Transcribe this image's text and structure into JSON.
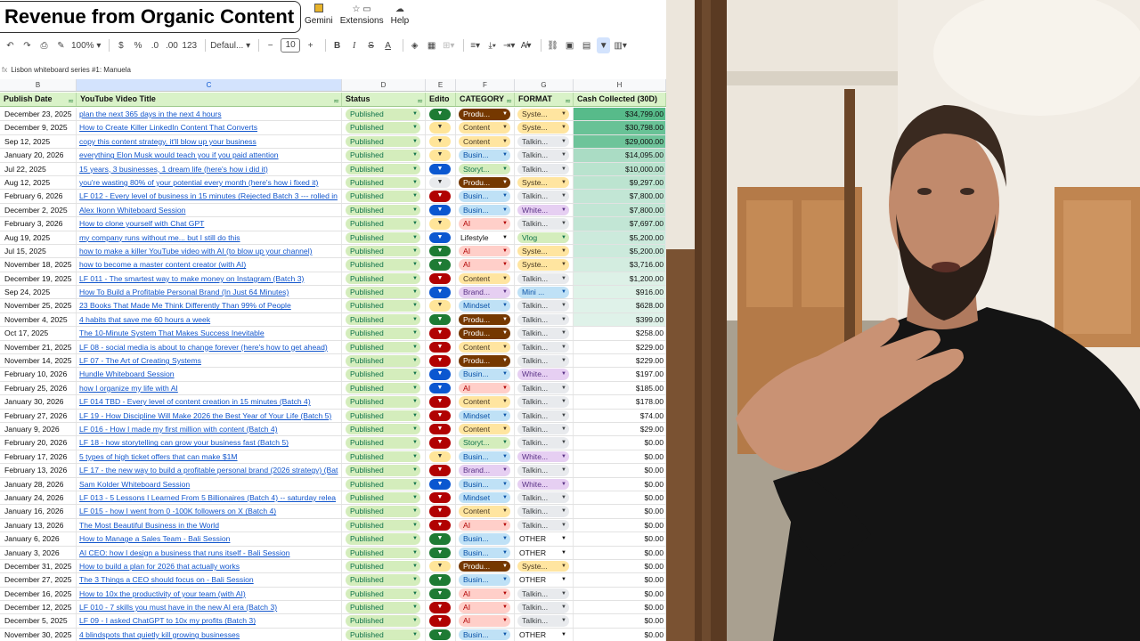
{
  "doc_title": "Revenue from Organic Content",
  "menu": [
    {
      "label": "Gemini",
      "icon": "gemini-icon"
    },
    {
      "label": "Extensions",
      "icon": "extensions-icon"
    },
    {
      "label": "Help",
      "icon": "help-icon"
    }
  ],
  "toolbar": {
    "zoom": "100%",
    "currency": "$",
    "percent": "%",
    "dec_less": ".0",
    "dec_more": ".00",
    "number_format": "123",
    "font": "Defaul...",
    "font_size": "10"
  },
  "formula_bar": {
    "value": "Lisbon whiteboard series #1: Manuela"
  },
  "columns": {
    "letters": [
      "B",
      "C",
      "D",
      "E",
      "F",
      "G",
      "H"
    ],
    "headers": {
      "publish_date": "Publish Date",
      "title": "YouTube Video Title",
      "status": "Status",
      "editor": "Edito",
      "category": "CATEGORY",
      "format": "FORMAT",
      "cash": "Cash Collected (30D)"
    }
  },
  "colors": {
    "status_bg": "#d4edbc",
    "editor_green": "#1e7b34",
    "editor_blue": "#0b57d0",
    "editor_red": "#b10202",
    "editor_yellow": "#ffe599",
    "editor_white": "#e8eaed",
    "cat_product": "#753800",
    "cat_content": "#ffe5a0",
    "cat_business": "#bfe1f6",
    "cat_story": "#d4edbc",
    "cat_ai": "#ffcfc9",
    "cat_brand": "#e6cff2",
    "cat_mindset": "#bfe1f6",
    "fmt_system": "#ffe5a0",
    "fmt_talking": "#e8eaed",
    "fmt_white": "#e6cff2",
    "fmt_vlog": "#d4edbc",
    "fmt_mini": "#bfe1f6",
    "cash_high": "#57bb8a"
  },
  "rows": [
    {
      "date": "December 23, 2025",
      "title": "plan the next 365 days in the next 4 hours",
      "status": "Published",
      "editor": "green",
      "category": "Produ...",
      "cat_style": "product",
      "format": "Syste...",
      "fmt_style": "system",
      "cash": "$34,799.00",
      "cash_level": 1.0
    },
    {
      "date": "December 9, 2025",
      "title": "How to Create Killer LinkedIn Content That Converts",
      "status": "Published",
      "editor": "yellow",
      "category": "Content",
      "cat_style": "content",
      "format": "Syste...",
      "fmt_style": "system",
      "cash": "$30,798.00",
      "cash_level": 0.88
    },
    {
      "date": "Sep 12, 2025",
      "title": "copy this content strategy, it'll blow up your business",
      "status": "Published",
      "editor": "yellow",
      "category": "Content",
      "cat_style": "content",
      "format": "Talkin...",
      "fmt_style": "talking",
      "cash": "$29,000.00",
      "cash_level": 0.83
    },
    {
      "date": "January 20, 2026",
      "title": "everything Elon Musk would teach you if you paid attention",
      "status": "Published",
      "editor": "yellow",
      "category": "Busin...",
      "cat_style": "business",
      "format": "Talkin...",
      "fmt_style": "talking",
      "cash": "$14,095.00",
      "cash_level": 0.4
    },
    {
      "date": "Jul 22, 2025",
      "title": "15 years, 3 businesses, 1 dream life (here's how i did it)",
      "status": "Published",
      "editor": "blue",
      "category": "Storyt...",
      "cat_style": "story",
      "format": "Talkin...",
      "fmt_style": "talking",
      "cash": "$10,000.00",
      "cash_level": 0.29
    },
    {
      "date": "Aug 12, 2025",
      "title": "you're wasting 80% of your potential every month (here's how i fixed it)",
      "status": "Published",
      "editor": "white",
      "category": "Produ...",
      "cat_style": "product",
      "format": "Syste...",
      "fmt_style": "system",
      "cash": "$9,297.00",
      "cash_level": 0.27
    },
    {
      "date": "February 6, 2026",
      "title": "LF 012 - Every level of business in 15 minutes (Rejected Batch 3 --- rolled in",
      "status": "Published",
      "editor": "red",
      "category": "Busin...",
      "cat_style": "business",
      "format": "Talkin...",
      "fmt_style": "talking",
      "cash": "$7,800.00",
      "cash_level": 0.22
    },
    {
      "date": "December 2, 2025",
      "title": "Alex Ikonn Whiteboard Session",
      "status": "Published",
      "editor": "blue",
      "category": "Busin...",
      "cat_style": "business",
      "format": "White...",
      "fmt_style": "white",
      "cash": "$7,800.00",
      "cash_level": 0.22
    },
    {
      "date": "February 3, 2026",
      "title": "How to clone yourself with Chat GPT",
      "status": "Published",
      "editor": "yellow",
      "category": "AI",
      "cat_style": "ai",
      "format": "Talkin...",
      "fmt_style": "talking",
      "cash": "$7,697.00",
      "cash_level": 0.22
    },
    {
      "date": "Aug 19, 2025",
      "title": "my company runs without me... but I still do this",
      "status": "Published",
      "editor": "blue",
      "category": "Lifestyle",
      "cat_style": "plain",
      "format": "Vlog",
      "fmt_style": "vlog",
      "cash": "$5,200.00",
      "cash_level": 0.15
    },
    {
      "date": "Jul 15, 2025",
      "title": "how to make a killer YouTube video with AI (to blow up your channel)",
      "status": "Published",
      "editor": "green",
      "category": "AI",
      "cat_style": "ai",
      "format": "Syste...",
      "fmt_style": "system",
      "cash": "$5,200.00",
      "cash_level": 0.15
    },
    {
      "date": "November 18, 2025",
      "title": "how to become a master content creator (with AI)",
      "status": "Published",
      "editor": "green",
      "category": "AI",
      "cat_style": "ai",
      "format": "Syste...",
      "fmt_style": "system",
      "cash": "$3,716.00",
      "cash_level": 0.1
    },
    {
      "date": "December 19, 2025",
      "title": "LF 011 - The smartest way to make money on Instagram (Batch 3)",
      "status": "Published",
      "editor": "red",
      "category": "Content",
      "cat_style": "content",
      "format": "Talkin...",
      "fmt_style": "talking",
      "cash": "$1,200.00",
      "cash_level": 0.03
    },
    {
      "date": "Sep 24, 2025",
      "title": "How To Build a Profitable Personal Brand (In Just 64 Minutes)",
      "status": "Published",
      "editor": "blue",
      "category": "Brand...",
      "cat_style": "brand",
      "format": "Mini ...",
      "fmt_style": "mini",
      "cash": "$916.00",
      "cash_level": 0.02
    },
    {
      "date": "November 25, 2025",
      "title": "23 Books That Made Me Think Differently Than 99% of People",
      "status": "Published",
      "editor": "yellow",
      "category": "Mindset",
      "cat_style": "mindset",
      "format": "Talkin...",
      "fmt_style": "talking",
      "cash": "$628.00",
      "cash_level": 0.01
    },
    {
      "date": "November 4, 2025",
      "title": "4 habits that save me 60 hours a week",
      "status": "Published",
      "editor": "green",
      "category": "Produ...",
      "cat_style": "product",
      "format": "Talkin...",
      "fmt_style": "talking",
      "cash": "$399.00",
      "cash_level": 0.01
    },
    {
      "date": "Oct 17, 2025",
      "title": "The 10-Minute System That Makes Success Inevitable",
      "status": "Published",
      "editor": "red",
      "category": "Produ...",
      "cat_style": "product",
      "format": "Talkin...",
      "fmt_style": "talking",
      "cash": "$258.00",
      "cash_level": 0.0
    },
    {
      "date": "November 21, 2025",
      "title": "LF 08 - social media is about to change forever (here's how to get ahead)",
      "status": "Published",
      "editor": "red",
      "category": "Content",
      "cat_style": "content",
      "format": "Talkin...",
      "fmt_style": "talking",
      "cash": "$229.00",
      "cash_level": 0.0
    },
    {
      "date": "November 14, 2025",
      "title": "LF 07 - The Art of Creating Systems",
      "status": "Published",
      "editor": "red",
      "category": "Produ...",
      "cat_style": "product",
      "format": "Talkin...",
      "fmt_style": "talking",
      "cash": "$229.00",
      "cash_level": 0.0
    },
    {
      "date": "February 10, 2026",
      "title": "Hundle Whiteboard Session",
      "status": "Published",
      "editor": "blue",
      "category": "Busin...",
      "cat_style": "business",
      "format": "White...",
      "fmt_style": "white",
      "cash": "$197.00",
      "cash_level": 0.0
    },
    {
      "date": "February 25, 2026",
      "title": "how I organize my life with AI",
      "status": "Published",
      "editor": "blue",
      "category": "AI",
      "cat_style": "ai",
      "format": "Talkin...",
      "fmt_style": "talking",
      "cash": "$185.00",
      "cash_level": 0.0
    },
    {
      "date": "January 30, 2026",
      "title": "LF 014 TBD - Every level of content creation in 15 minutes (Batch 4)",
      "status": "Published",
      "editor": "red",
      "category": "Content",
      "cat_style": "content",
      "format": "Talkin...",
      "fmt_style": "talking",
      "cash": "$178.00",
      "cash_level": 0.0
    },
    {
      "date": "February 27, 2026",
      "title": "LF 19 - How Discipline Will Make 2026 the Best Year of Your Life (Batch 5)",
      "status": "Published",
      "editor": "red",
      "category": "Mindset",
      "cat_style": "mindset",
      "format": "Talkin...",
      "fmt_style": "talking",
      "cash": "$74.00",
      "cash_level": 0.0
    },
    {
      "date": "January 9, 2026",
      "title": "LF 016 - How I made my first million with content (Batch 4)",
      "status": "Published",
      "editor": "red",
      "category": "Content",
      "cat_style": "content",
      "format": "Talkin...",
      "fmt_style": "talking",
      "cash": "$29.00",
      "cash_level": 0.0
    },
    {
      "date": "February 20, 2026",
      "title": "LF 18 - how storytelling can grow your business fast (Batch 5)",
      "status": "Published",
      "editor": "red",
      "category": "Storyt...",
      "cat_style": "story",
      "format": "Talkin...",
      "fmt_style": "talking",
      "cash": "$0.00",
      "cash_level": 0.0
    },
    {
      "date": "February 17, 2026",
      "title": "5 types of high ticket offers that can make $1M",
      "status": "Published",
      "editor": "yellow",
      "category": "Busin...",
      "cat_style": "business",
      "format": "White...",
      "fmt_style": "white",
      "cash": "$0.00",
      "cash_level": 0.0
    },
    {
      "date": "February 13, 2026",
      "title": "LF 17 - the new way to build a profitable personal brand (2026 strategy) (Bat",
      "status": "Published",
      "editor": "red",
      "category": "Brand...",
      "cat_style": "brand",
      "format": "Talkin...",
      "fmt_style": "talking",
      "cash": "$0.00",
      "cash_level": 0.0
    },
    {
      "date": "January 28, 2026",
      "title": "Sam Kolder Whiteboard Session",
      "status": "Published",
      "editor": "blue",
      "category": "Busin...",
      "cat_style": "business",
      "format": "White...",
      "fmt_style": "white",
      "cash": "$0.00",
      "cash_level": 0.0
    },
    {
      "date": "January 24, 2026",
      "title": "LF 013 - 5 Lessons I Learned From 5 Billionaires (Batch 4) -- saturday relea",
      "status": "Published",
      "editor": "red",
      "category": "Mindset",
      "cat_style": "mindset",
      "format": "Talkin...",
      "fmt_style": "talking",
      "cash": "$0.00",
      "cash_level": 0.0
    },
    {
      "date": "January 16, 2026",
      "title": "LF 015 - how I went from 0 -100K followers on X (Batch 4)",
      "status": "Published",
      "editor": "red",
      "category": "Content",
      "cat_style": "content",
      "format": "Talkin...",
      "fmt_style": "talking",
      "cash": "$0.00",
      "cash_level": 0.0
    },
    {
      "date": "January 13, 2026",
      "title": "The Most Beautiful Business in the World",
      "status": "Published",
      "editor": "red",
      "category": "AI",
      "cat_style": "ai",
      "format": "Talkin...",
      "fmt_style": "talking",
      "cash": "$0.00",
      "cash_level": 0.0
    },
    {
      "date": "January 6, 2026",
      "title": "How to Manage a Sales Team - Bali Session",
      "status": "Published",
      "editor": "green",
      "category": "Busin...",
      "cat_style": "business",
      "format": "OTHER",
      "fmt_style": "plain",
      "cash": "$0.00",
      "cash_level": 0.0
    },
    {
      "date": "January 3, 2026",
      "title": "AI CEO: how I design a business that runs itself - Bali Session",
      "status": "Published",
      "editor": "green",
      "category": "Busin...",
      "cat_style": "business",
      "format": "OTHER",
      "fmt_style": "plain",
      "cash": "$0.00",
      "cash_level": 0.0
    },
    {
      "date": "December 31, 2025",
      "title": "How to build a plan for 2026 that actually works",
      "status": "Published",
      "editor": "yellow",
      "category": "Produ...",
      "cat_style": "product",
      "format": "Syste...",
      "fmt_style": "system",
      "cash": "$0.00",
      "cash_level": 0.0
    },
    {
      "date": "December 27, 2025",
      "title": "The 3 Things a CEO should focus on - Bali Session",
      "status": "Published",
      "editor": "green",
      "category": "Busin...",
      "cat_style": "business",
      "format": "OTHER",
      "fmt_style": "plain",
      "cash": "$0.00",
      "cash_level": 0.0
    },
    {
      "date": "December 16, 2025",
      "title": "How to 10x the productivity of your team (with AI)",
      "status": "Published",
      "editor": "green",
      "category": "AI",
      "cat_style": "ai",
      "format": "Talkin...",
      "fmt_style": "talking",
      "cash": "$0.00",
      "cash_level": 0.0
    },
    {
      "date": "December 12, 2025",
      "title": "LF 010 - 7 skills you must have in the new AI era (Batch 3)",
      "status": "Published",
      "editor": "red",
      "category": "AI",
      "cat_style": "ai",
      "format": "Talkin...",
      "fmt_style": "talking",
      "cash": "$0.00",
      "cash_level": 0.0
    },
    {
      "date": "December 5, 2025",
      "title": "LF 09 - I asked ChatGPT to 10x my profits (Batch 3)",
      "status": "Published",
      "editor": "red",
      "category": "AI",
      "cat_style": "ai",
      "format": "Talkin...",
      "fmt_style": "talking",
      "cash": "$0.00",
      "cash_level": 0.0
    },
    {
      "date": "November 30, 2025",
      "title": "4 blindspots that quietly kill growing businesses",
      "status": "Published",
      "editor": "green",
      "category": "Busin...",
      "cat_style": "business",
      "format": "OTHER",
      "fmt_style": "plain",
      "cash": "$0.00",
      "cash_level": 0.0
    }
  ]
}
